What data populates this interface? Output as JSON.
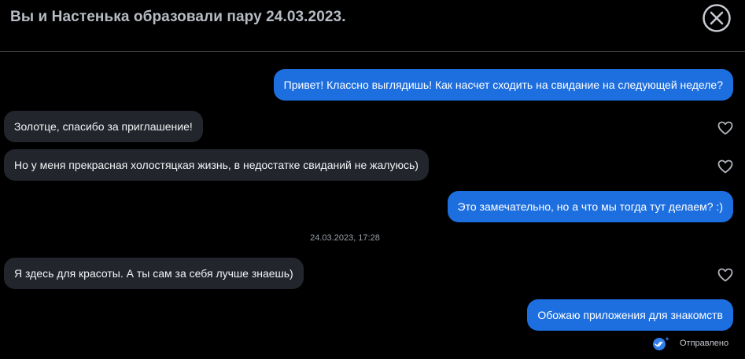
{
  "header": {
    "title": "Вы и Настенька образовали пару 24.03.2023."
  },
  "messages": [
    {
      "text": "Привет! Классно выглядишь! Как насчет сходить на свидание на следующей неделе?"
    },
    {
      "text": "Золотце, спасибо за приглашение!"
    },
    {
      "text": "Но у меня прекрасная холостяцкая жизнь, в недостатке свиданий не жалуюсь)"
    },
    {
      "text": "Это замечательно, но а что мы тогда тут делаем? :)"
    },
    {
      "text": "Я здесь для красоты. А ты сам за себя лучше знаешь)"
    },
    {
      "text": "Обожаю приложения для знакомств"
    }
  ],
  "timestamp": "24.03.2023, 17:28",
  "status_text": "Отправлено",
  "colors": {
    "outgoing_bubble": "#1d6fe0",
    "incoming_bubble": "#22252b",
    "background": "#000000",
    "sent_check": "#2f7de8"
  },
  "icons": {
    "close": "close-circle-x-icon",
    "like": "heart-outline-icon",
    "sent": "double-check-icon"
  }
}
